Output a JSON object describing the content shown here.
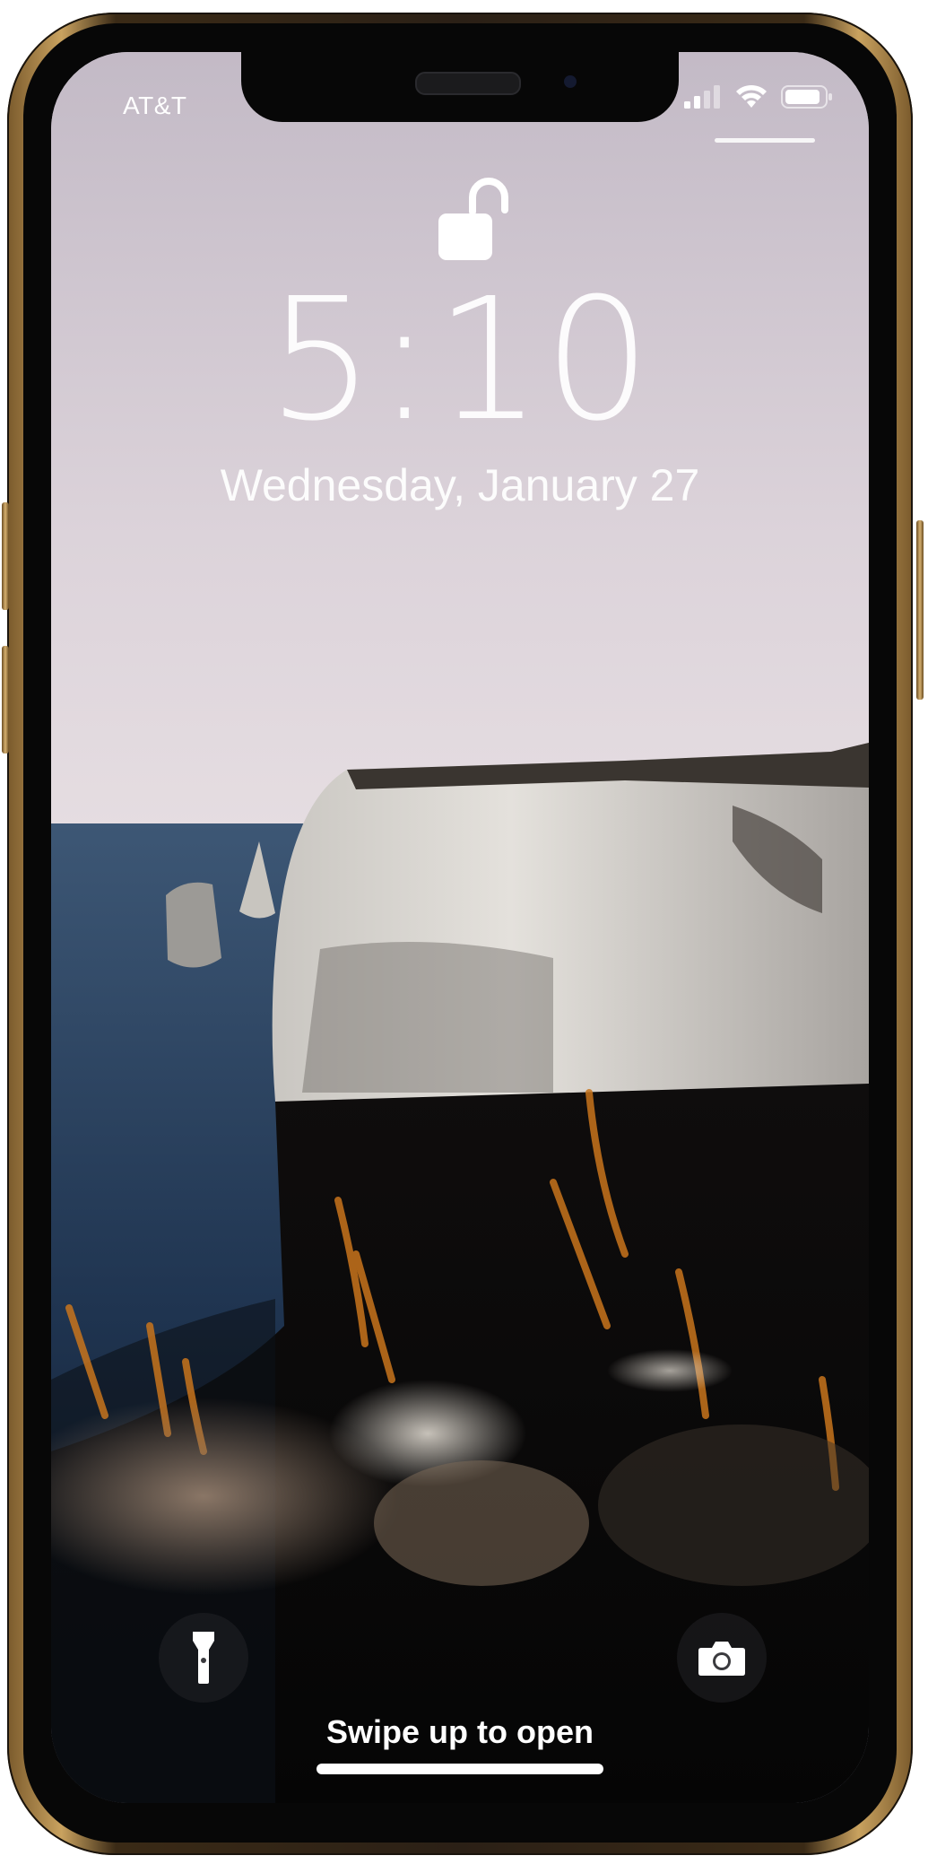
{
  "status_bar": {
    "carrier": "AT&T",
    "signal_icon": "cellular-signal-icon",
    "wifi_icon": "wifi-icon",
    "battery_icon": "battery-icon"
  },
  "lock_screen": {
    "lock_icon": "unlocked-padlock-icon",
    "time": "5:10",
    "date": "Wednesday, January 27",
    "flashlight_icon": "flashlight-icon",
    "camera_icon": "camera-icon",
    "swipe_hint": "Swipe up to open"
  },
  "colors": {
    "sky": "#cfc6cf",
    "sea": "#243650",
    "cliff": "#d6d3ce",
    "phone_frame_gold": "#c9a25f",
    "text": "#ffffff"
  }
}
